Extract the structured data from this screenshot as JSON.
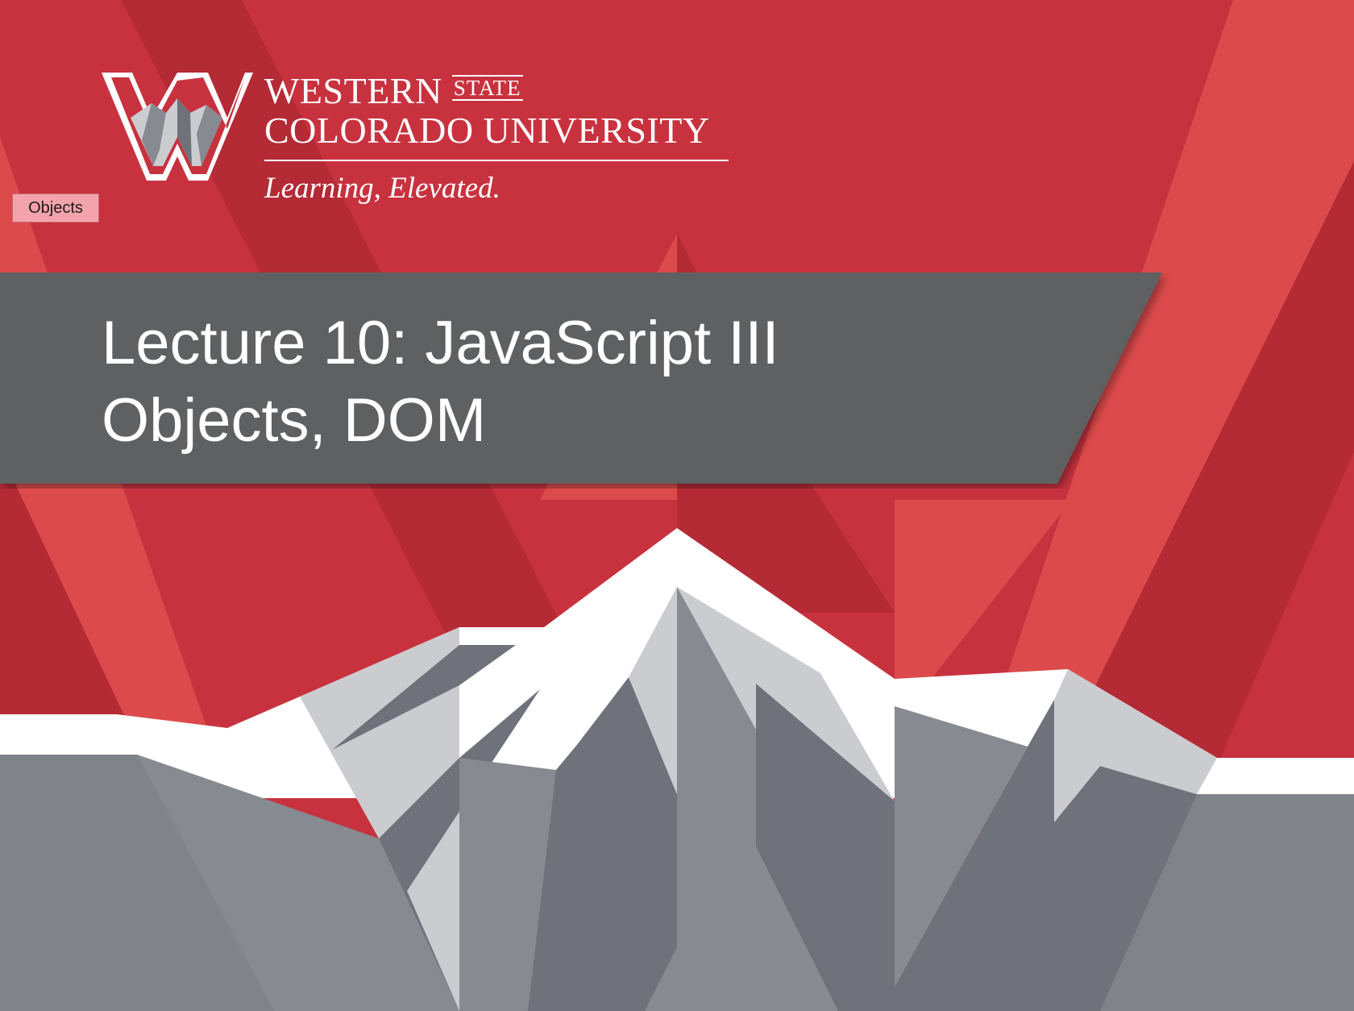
{
  "university": {
    "name_line1": "WESTERN",
    "state_word": "STATE",
    "name_line2": "COLORADO UNIVERSITY",
    "tagline": "Learning, Elevated."
  },
  "badge": {
    "label": "Objects"
  },
  "title": {
    "line1": "Lecture 10: JavaScript III",
    "line2": "Objects, DOM"
  },
  "colors": {
    "red_mid": "#c8323f",
    "red_dark": "#b42a35",
    "red_light": "#dc4a4b",
    "band_gray": "#5f6062",
    "mountain_light": "#cbccd0",
    "mountain_mid": "#878a90",
    "mountain_dark": "#6f727a"
  }
}
